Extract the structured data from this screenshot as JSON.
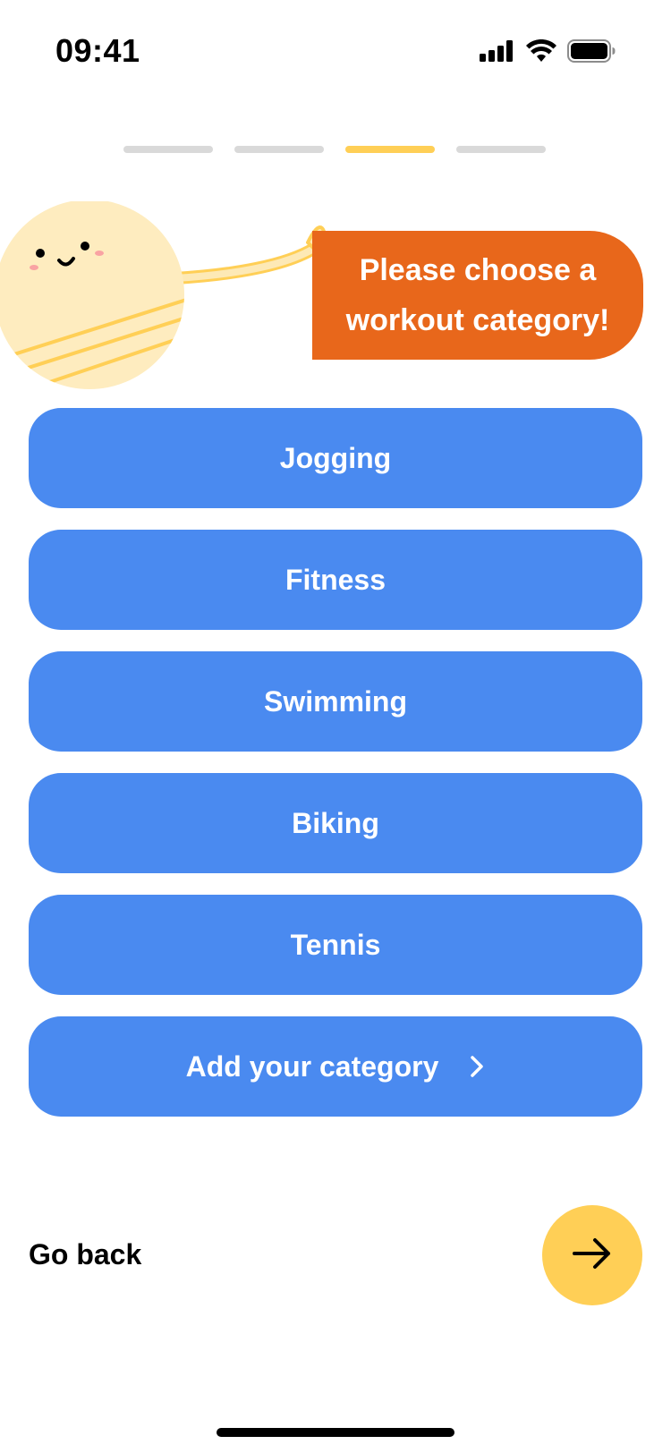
{
  "status_bar": {
    "time": "09:41",
    "icons": [
      "cellular-signal-icon",
      "wifi-icon",
      "battery-icon"
    ]
  },
  "progress": {
    "total_steps": 4,
    "current_step": 3,
    "active_color": "#ffcf56",
    "inactive_color": "#d9d9d9"
  },
  "prompt": {
    "text": "Please choose a workout category!",
    "bubble_color": "#e8671b"
  },
  "categories": {
    "button_color": "#4a8af0",
    "items": [
      {
        "label": "Jogging"
      },
      {
        "label": "Fitness"
      },
      {
        "label": "Swimming"
      },
      {
        "label": "Biking"
      },
      {
        "label": "Tennis"
      },
      {
        "label": "Add your category",
        "icon": "chevron-right-icon"
      }
    ]
  },
  "footer": {
    "back_label": "Go back",
    "next_icon": "arrow-right-icon",
    "next_color": "#ffcf56"
  }
}
